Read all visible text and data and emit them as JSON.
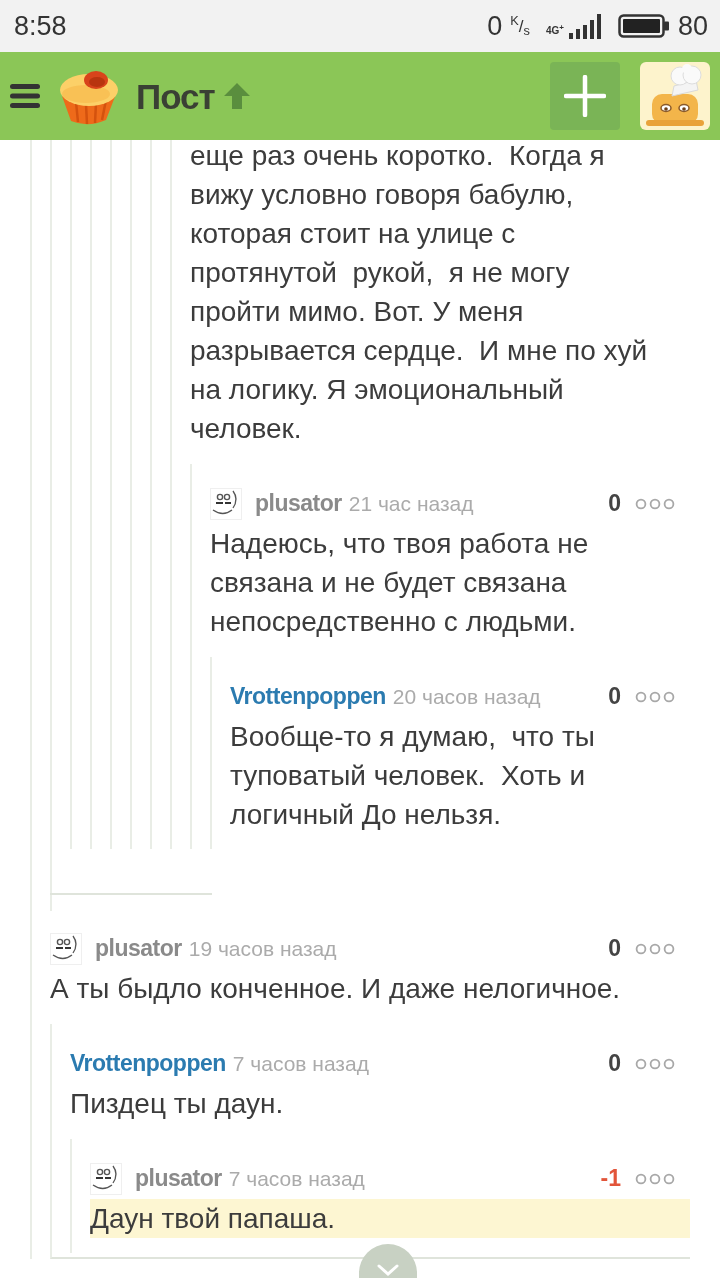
{
  "status_bar": {
    "time": "8:58",
    "speed": "0",
    "speed_unit": "$^{K}$/$_{s}$",
    "network": "4G$^{+}$",
    "battery": "80"
  },
  "header": {
    "title": "Пост"
  },
  "thread": [
    {
      "children": [
        {
          "children": [
            {
              "children": [
                {
                  "children": [
                    {
                      "children": [
                        {
                          "children": [
                            {
                              "children": [
                                {
                                  "children": [
                                    {
                                      "body": "еще раз очень коротко.  Когда я\nвижу условно говоря бабулю,\nкоторая стоит на улице с\nпротянутой  рукой,  я не могу\nпройти мимо. Вот. У меня\nразрывается сердце.  И мне по хуй\nна логику. Я эмоциональный\nчеловек.",
                                      "children": [
                                        {
                                          "author": "plusator",
                                          "color": "#8a8a8a",
                                          "has_avatar": true,
                                          "time": "21 час назад",
                                          "score": "0",
                                          "negative": false,
                                          "highlighted": false,
                                          "collapse_control": false,
                                          "body": "Надеюсь, что твоя работа не\nсвязана и не будет связана\nнепосредственно с людьми.",
                                          "children": [
                                            {
                                              "author": "Vrottenpoppen",
                                              "color": "#2b7bb0",
                                              "has_avatar": false,
                                              "time": "20 часов назад",
                                              "score": "0",
                                              "negative": false,
                                              "highlighted": false,
                                              "collapse_control": false,
                                              "body": "Вообще-то я думаю,  что ты\nтуповатый человек.  Хоть и\nлогичный До нельзя."
                                            }
                                          ]
                                        }
                                      ]
                                    }
                                  ]
                                }
                              ]
                            }
                          ]
                        }
                      ]
                    }
                  ]
                }
              ]
            }
          ]
        },
        {
          "author": "plusator",
          "color": "#8a8a8a",
          "has_avatar": true,
          "time": "19 часов назад",
          "score": "0",
          "negative": false,
          "highlighted": false,
          "collapse_control": true,
          "body": "А ты быдло конченное. И даже нелогичное.",
          "children": [
            {
              "author": "Vrottenpoppen",
              "color": "#2b7bb0",
              "has_avatar": false,
              "time": "7 часов назад",
              "score": "0",
              "negative": false,
              "highlighted": false,
              "collapse_control": false,
              "body": "Пиздец ты даун.",
              "children": [
                {
                  "author": "plusator",
                  "color": "#8a8a8a",
                  "has_avatar": true,
                  "time": "7 часов назад",
                  "score": "-1",
                  "negative": true,
                  "highlighted": true,
                  "collapse_control": false,
                  "body": "Даун твой папаша."
                }
              ]
            }
          ]
        }
      ]
    }
  ]
}
